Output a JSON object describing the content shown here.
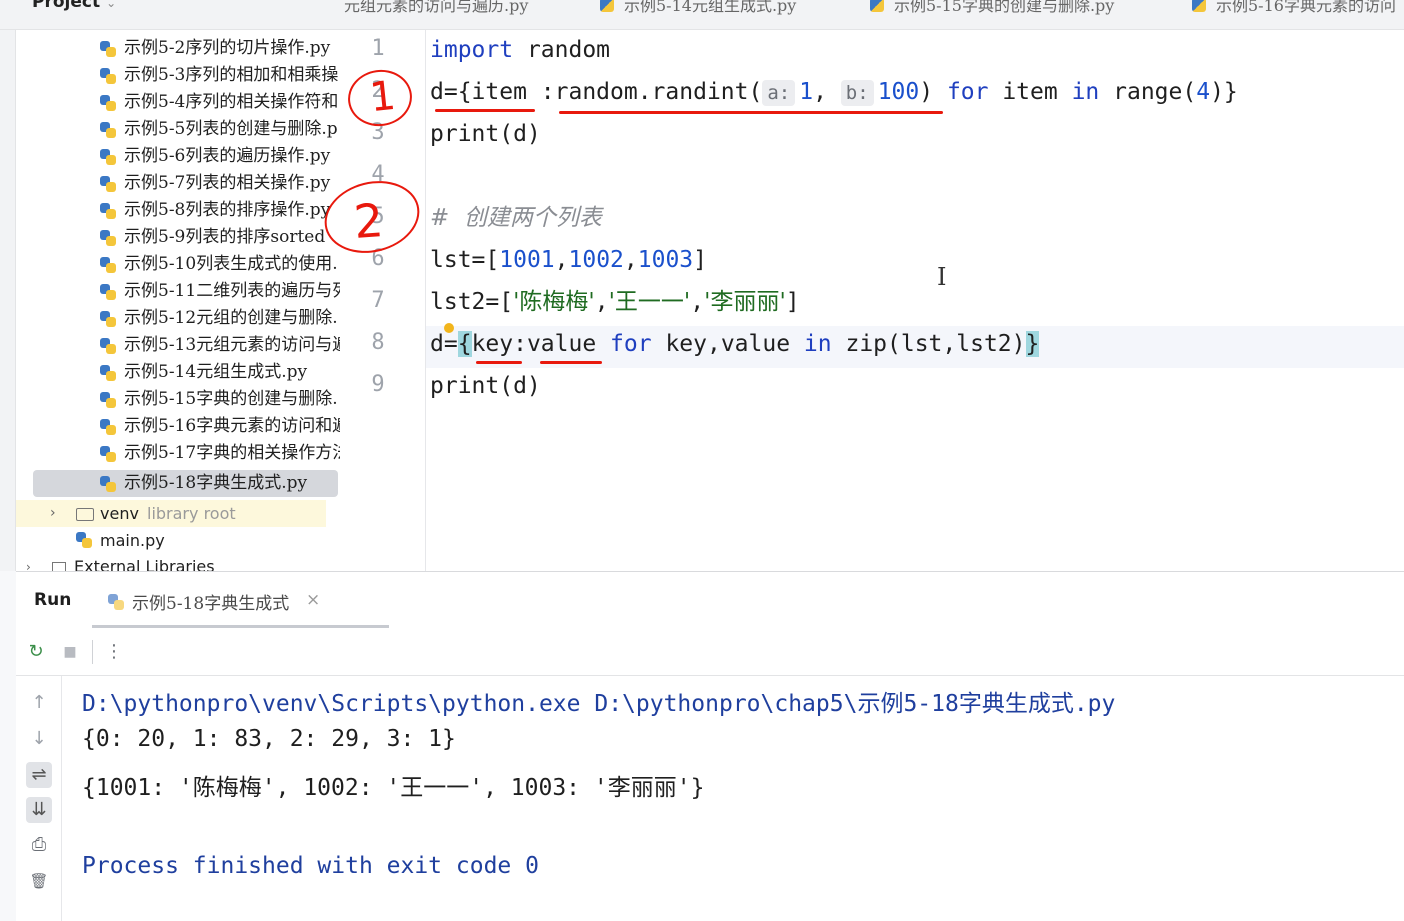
{
  "project_header": {
    "title": "Project"
  },
  "editor_tabs": [
    "元组元素的访问与遍历.py",
    "示例5-14元组生成式.py",
    "示例5-15字典的创建与删除.py",
    "示例5-16字典元素的访问"
  ],
  "project_tree": {
    "files": [
      "示例5-2序列的切片操作.py",
      "示例5-3序列的相加和相乘操",
      "示例5-4序列的相关操作符和",
      "示例5-5列表的创建与删除.p",
      "示例5-6列表的遍历操作.py",
      "示例5-7列表的相关操作.py",
      "示例5-8列表的排序操作.py",
      "示例5-9列表的排序sorted",
      "示例5-10列表生成式的使用.",
      "示例5-11二维列表的遍历与列",
      "示例5-12元组的创建与删除.",
      "示例5-13元组元素的访问与遍",
      "示例5-14元组生成式.py",
      "示例5-15字典的创建与删除.",
      "示例5-16字典元素的访问和遍",
      "示例5-17字典的相关操作方法",
      "示例5-18字典生成式.py"
    ],
    "selected_file": "示例5-18字典生成式.py",
    "venv": {
      "name": "venv",
      "hint": "library root"
    },
    "main_file": "main.py",
    "external": "External Libraries"
  },
  "editor": {
    "line_numbers": [
      "1",
      "2",
      "3",
      "4",
      "5",
      "6",
      "7",
      "8",
      "9"
    ],
    "hints": {
      "a": "a:",
      "b": "b:"
    },
    "lines": {
      "l1_kw": "import",
      "l1_rest": " random",
      "l2_a": "d={item :random.randint(",
      "l2_n1": "1",
      "l2_comma": ", ",
      "l2_n2": "100",
      "l2_paren": ") ",
      "l2_for": "for",
      "l2_item": " item ",
      "l2_in": "in",
      "l2_range": " range(",
      "l2_n3": "4",
      "l2_end": ")}",
      "l3": "print(d)",
      "l5_comment": "#  创建两个列表",
      "l6_a": "lst=[",
      "l6_n1": "1001",
      "l6_c1": ",",
      "l6_n2": "1002",
      "l6_c2": ",",
      "l6_n3": "1003",
      "l6_end": "]",
      "l7_a": "lst2=[",
      "l7_s1": "'陈梅梅'",
      "l7_c1": ",",
      "l7_s2": "'王一一'",
      "l7_c2": ",",
      "l7_s3": "'李丽丽'",
      "l7_end": "]",
      "l8_a": "d=",
      "l8_open": "{",
      "l8_b": "key:value ",
      "l8_for": "for",
      "l8_c": " key,value ",
      "l8_in": "in",
      "l8_d": " zip(lst,lst2)",
      "l8_close": "}",
      "l9": "print(d)"
    }
  },
  "annotations": {
    "mark1": "1",
    "mark2": "2"
  },
  "run_panel": {
    "title": "Run",
    "tab_label": "示例5-18字典生成式",
    "tab_close": "×",
    "toolbar": {
      "rerun": "↻",
      "stop": "■",
      "more": "⋮"
    },
    "side_tools": {
      "up": "↑",
      "down": "↓",
      "wrap": "⇌",
      "scroll_end": "⇊",
      "print": "⎙",
      "trash": "🗑"
    },
    "console": {
      "command": "D:\\pythonpro\\venv\\Scripts\\python.exe D:\\pythonpro\\chap5\\示例5-18字典生成式.py",
      "output1": "{0: 20, 1: 83, 2: 29, 3: 1}",
      "output2": "{1001: '陈梅梅', 1002: '王一一', 1003: '李丽丽'}",
      "exit": "Process finished with exit code 0"
    }
  },
  "colors": {
    "keyword": "#1f3fbf",
    "number": "#1a50cc",
    "string": "#1f6b21",
    "annotation_red": "#e8190d",
    "brace_highlight": "#9fd7df"
  }
}
